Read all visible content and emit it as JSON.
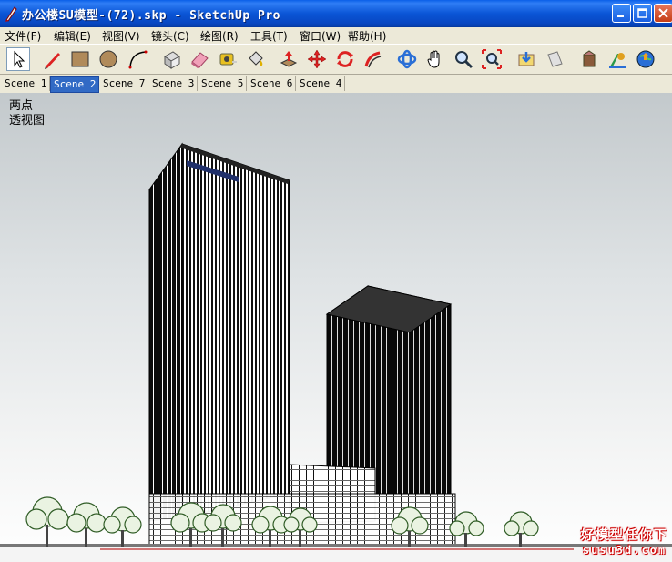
{
  "window": {
    "title": "办公楼SU模型-(72).skp - SketchUp Pro"
  },
  "menu": [
    {
      "label": "文件(F)"
    },
    {
      "label": "编辑(E)"
    },
    {
      "label": "视图(V)"
    },
    {
      "label": "镜头(C)"
    },
    {
      "label": "绘图(R)"
    },
    {
      "label": "工具(T)"
    },
    {
      "label": "窗口(W)"
    },
    {
      "label": "帮助(H)"
    }
  ],
  "toolbar": {
    "tools": [
      "select-tool-icon",
      "pencil-line-icon",
      "rectangle-icon",
      "circle-icon",
      "arc-icon",
      "make-component-icon",
      "eraser-icon",
      "tape-measure-icon",
      "paint-bucket-icon",
      "push-pull-icon",
      "move-icon",
      "rotate-icon",
      "follow-me-icon",
      "orbit-icon",
      "pan-icon",
      "zoom-icon",
      "zoom-extents-icon",
      "get-models-icon",
      "share-model-icon",
      "component-icon",
      "get-photo-texture-icon",
      "google-earth-icon"
    ]
  },
  "scenes": {
    "tabs": [
      "Scene 1",
      "Scene 2",
      "Scene 7",
      "Scene 3",
      "Scene 5",
      "Scene 6",
      "Scene 4"
    ],
    "selected": "Scene 2"
  },
  "viewport": {
    "label_line1": "两点",
    "label_line2": "透视图",
    "watermark_line1": "好模型任你下",
    "watermark_line2": "susu3d.com"
  },
  "colors": {
    "titlebar": "#0a55d6",
    "selected_tab": "#316ac5",
    "watermark": "#cc0000"
  }
}
